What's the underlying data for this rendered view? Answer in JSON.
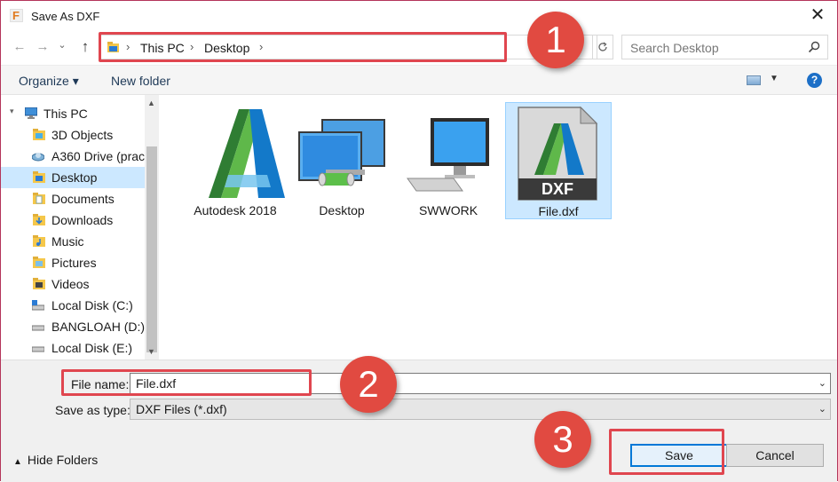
{
  "window": {
    "title": "Save As DXF",
    "close_symbol": "✕"
  },
  "nav": {
    "back_symbol": "←",
    "forward_symbol": "→",
    "recent_symbol": "⌄",
    "up_symbol": "↑"
  },
  "address": {
    "crumbs": [
      "This PC",
      "Desktop"
    ],
    "separator": "›"
  },
  "search": {
    "placeholder": "Search Desktop"
  },
  "toolbar": {
    "organize": "Organize ▾",
    "new_folder": "New folder",
    "help": "?"
  },
  "tree": {
    "items": [
      {
        "label": "This PC",
        "icon": "pc-icon"
      },
      {
        "label": "3D Objects",
        "icon": "folder-icon"
      },
      {
        "label": "A360 Drive (prac",
        "icon": "cloud-drive-icon"
      },
      {
        "label": "Desktop",
        "icon": "folder-icon",
        "selected": true
      },
      {
        "label": "Documents",
        "icon": "folder-icon"
      },
      {
        "label": "Downloads",
        "icon": "folder-icon"
      },
      {
        "label": "Music",
        "icon": "folder-icon"
      },
      {
        "label": "Pictures",
        "icon": "folder-icon"
      },
      {
        "label": "Videos",
        "icon": "folder-icon"
      },
      {
        "label": "Local Disk (C:)",
        "icon": "drive-icon"
      },
      {
        "label": "BANGLOAH (D:)",
        "icon": "drive-icon"
      },
      {
        "label": "Local Disk (E:)",
        "icon": "drive-icon"
      }
    ]
  },
  "files": [
    {
      "label": "Autodesk 2018",
      "icon": "autodesk-icon"
    },
    {
      "label": "Desktop",
      "icon": "network-desktop-icon"
    },
    {
      "label": "SWWORK",
      "icon": "computer-icon"
    },
    {
      "label": "File.dxf",
      "icon": "dxf-file-icon",
      "badge": "DXF",
      "selected": true
    }
  ],
  "form": {
    "file_name_label": "File name:",
    "file_name_value": "File.dxf",
    "save_type_label": "Save as type:",
    "save_type_value": "DXF Files (*.dxf)",
    "hide_folders": "Hide Folders"
  },
  "buttons": {
    "save": "Save",
    "cancel": "Cancel"
  },
  "callouts": [
    "1",
    "2",
    "3"
  ],
  "colors": {
    "highlight": "#e0464f",
    "callout": "#e14a41",
    "selection": "#cce8ff"
  }
}
